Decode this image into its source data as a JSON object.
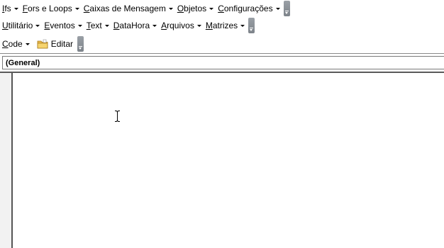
{
  "toolbar1": {
    "menus": [
      {
        "label": "Ifs",
        "acc": "I"
      },
      {
        "label": "Fors e Loops",
        "acc": "F"
      },
      {
        "label": "Caixas de Mensagem",
        "acc": "C"
      },
      {
        "label": "Objetos",
        "acc": "O"
      },
      {
        "label": "Configurações",
        "acc": "C"
      }
    ]
  },
  "toolbar2": {
    "menus": [
      {
        "label": "Utilitário",
        "acc": "U"
      },
      {
        "label": "Eventos",
        "acc": "E"
      },
      {
        "label": "Text",
        "acc": "T"
      },
      {
        "label": "DataHora",
        "acc": "D"
      },
      {
        "label": "Arquivos",
        "acc": "A"
      },
      {
        "label": "Matrizes",
        "acc": "M"
      }
    ]
  },
  "toolbar3": {
    "code_menu": {
      "label": "Code",
      "acc": "C"
    },
    "edit_button": "Editar"
  },
  "object_combo": {
    "value": "(General)"
  },
  "colors": {
    "caret": "#000000",
    "grip": "#8a9096",
    "folder": "#e8b84a"
  },
  "icons": {
    "folder": "folder-icon",
    "text_cursor": "i-beam-cursor-icon",
    "grip": "toolbar-overflow-grip-icon"
  }
}
